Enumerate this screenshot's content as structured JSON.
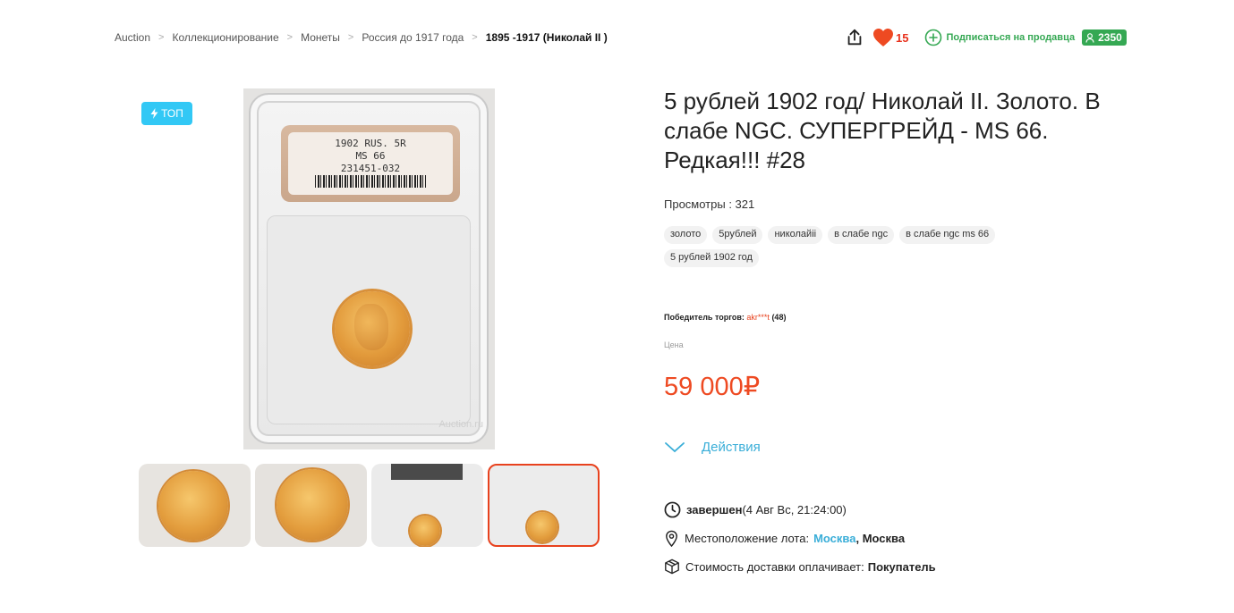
{
  "breadcrumb": {
    "items": [
      "Auction",
      "Коллекционирование",
      "Монеты",
      "Россия до 1917 года",
      "1895 -1917 (Николай II )"
    ],
    "separator": ">"
  },
  "header_actions": {
    "favorites_count": "15",
    "subscribe_label": "Подписаться на продавца",
    "seller_rating": "2350"
  },
  "gallery": {
    "top_badge": "ТОП",
    "slab_label": {
      "line1": "1902 RUS. 5R",
      "line2": "MS 66",
      "line3": "231451-032"
    },
    "watermark": "Auction.ru"
  },
  "lot": {
    "title": "5 рублей 1902 год/ Николай II. Золото. В слабе NGC. СУПЕРГРЕЙД - MS 66. Редкая!!! #28",
    "views_label": "Просмотры : 321",
    "tags": [
      "золото",
      "5рублей",
      "николайii",
      "в слабе ngc",
      "в слабе ngc ms 66",
      "5 рублей 1902 год"
    ],
    "winner_label": "Победитель торгов:",
    "winner_nick": "akr***t",
    "winner_count": "(48)",
    "price_label": "Цена",
    "price": "59 000₽",
    "actions_label": "Действия",
    "status_label": "завершен",
    "status_date": "(4 Авг Вс, 21:24:00)",
    "location_label": "Местоположение лота:",
    "location_city_link": "Москва",
    "location_region": ", Москва",
    "shipping_label": "Стоимость доставки оплачивает:",
    "shipping_payer": "Покупатель"
  },
  "colors": {
    "accent_red": "#ee4a22",
    "accent_green": "#35a853",
    "accent_blue": "#3aaed8",
    "badge_blue": "#32c8f5"
  }
}
